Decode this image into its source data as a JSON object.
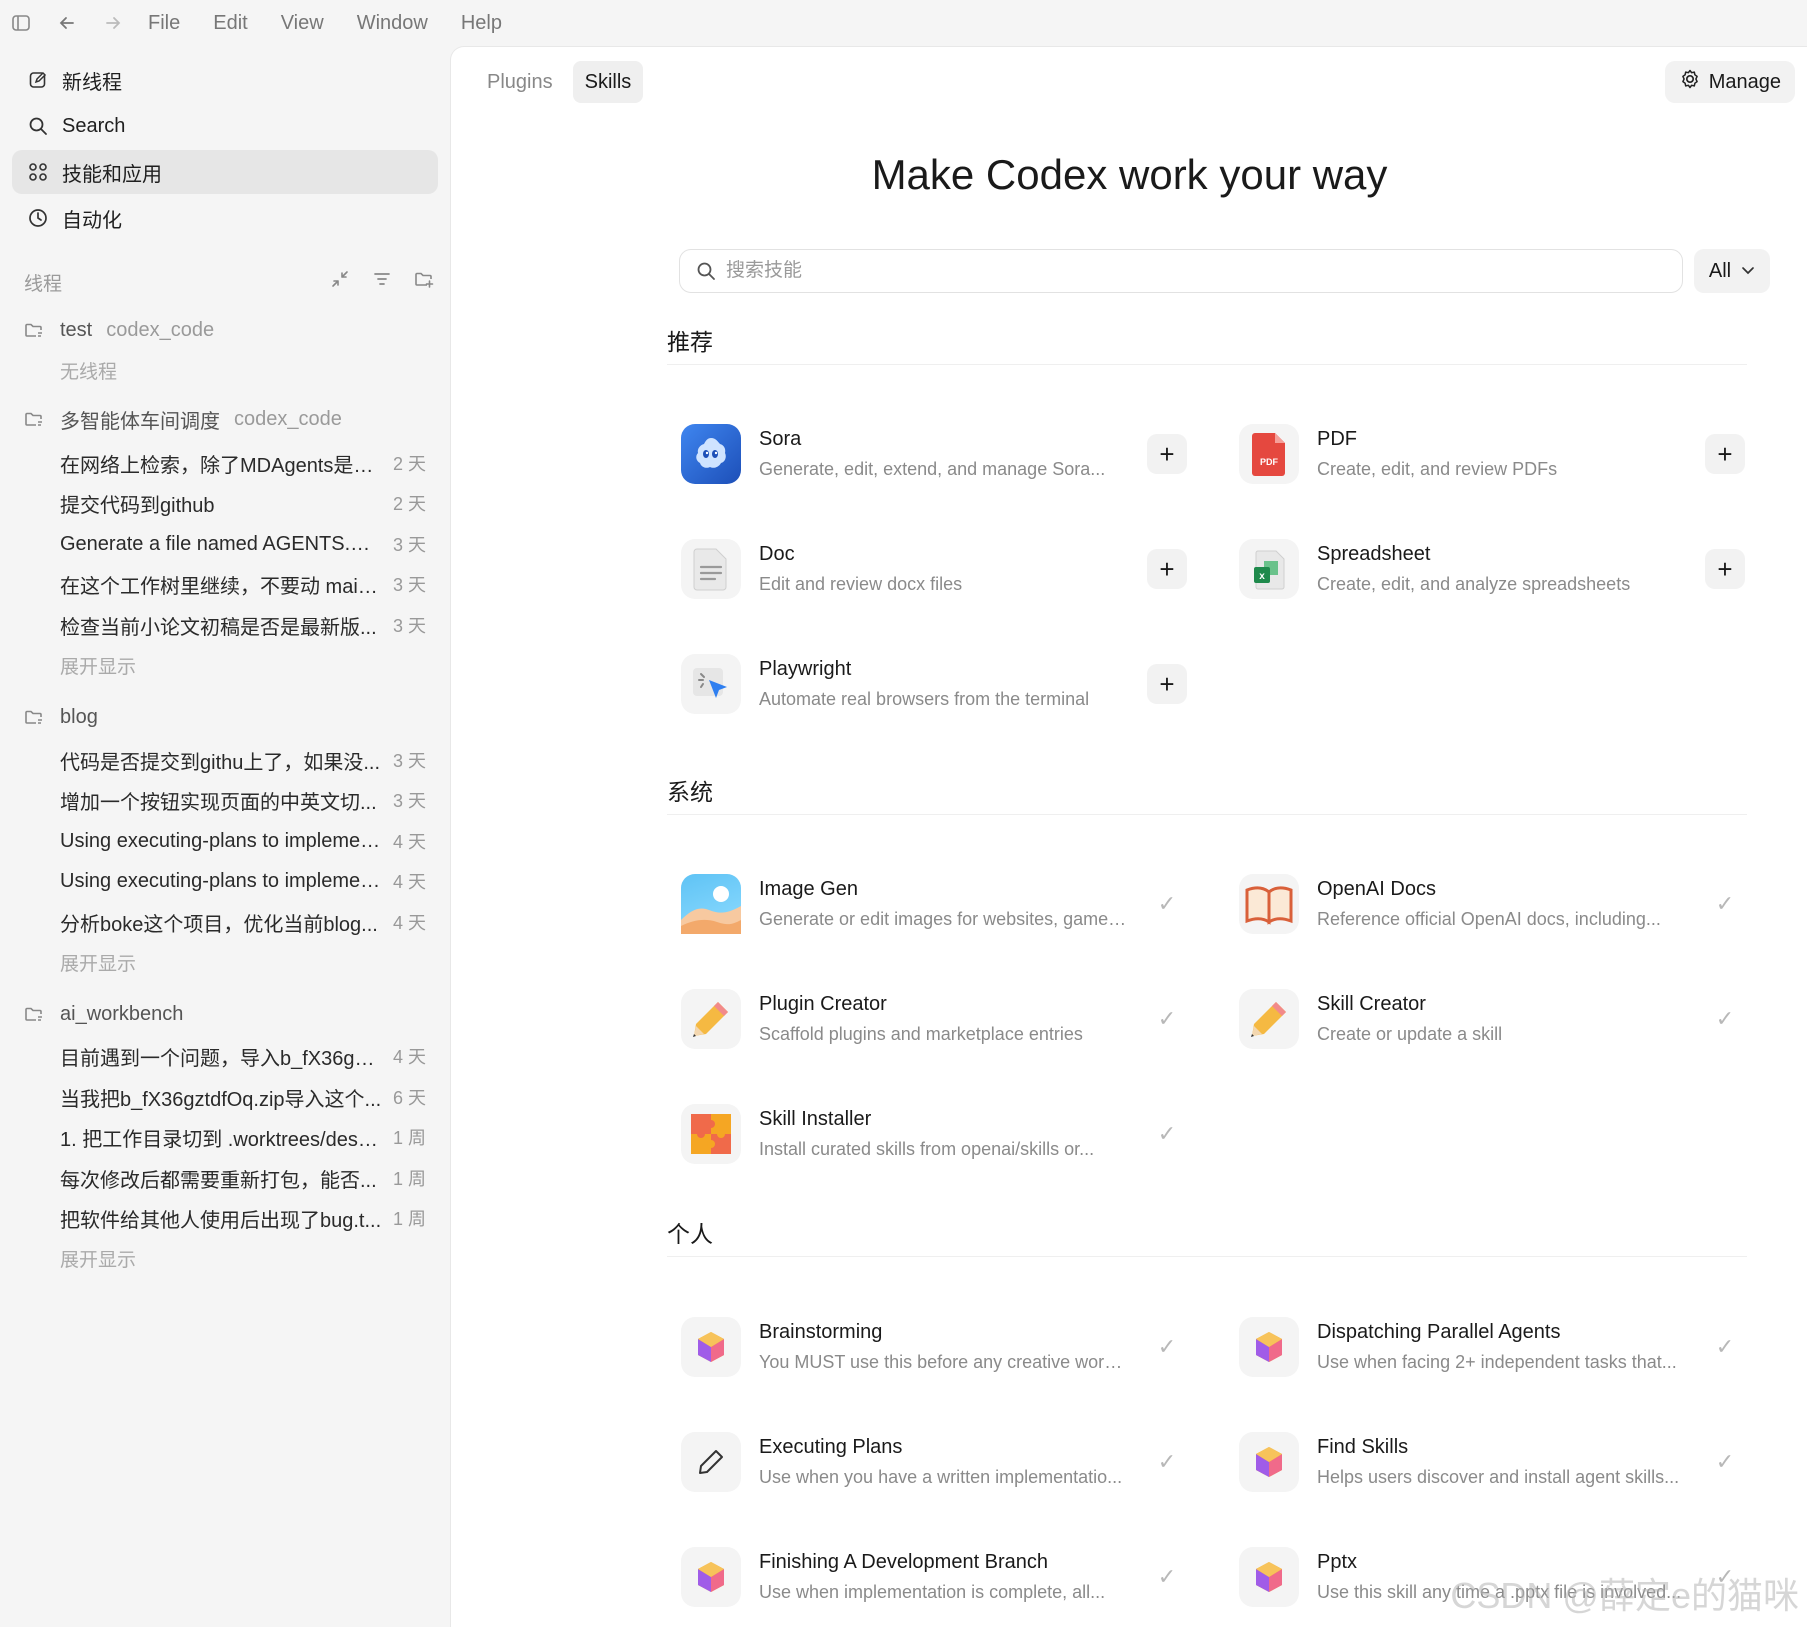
{
  "menubar": {
    "items": [
      "File",
      "Edit",
      "View",
      "Window",
      "Help"
    ]
  },
  "sidebar": {
    "nav": [
      {
        "label": "新线程",
        "icon": "edit-icon"
      },
      {
        "label": "Search",
        "icon": "search-icon"
      },
      {
        "label": "技能和应用",
        "icon": "apps-icon",
        "active": true
      },
      {
        "label": "自动化",
        "icon": "clock-icon"
      }
    ],
    "threads_heading": "线程",
    "projects": [
      {
        "name": "test",
        "sub": "codex_code",
        "empty": "无线程",
        "threads": []
      },
      {
        "name": "多智能体车间调度",
        "sub": "codex_code",
        "threads": [
          {
            "title": "在网络上检索，除了MDAgents是否...",
            "time": "2 天"
          },
          {
            "title": "提交代码到github",
            "time": "2 天"
          },
          {
            "title": "Generate a file named AGENTS.md ...",
            "time": "3 天"
          },
          {
            "title": "在这个工作树里继续，不要动 main...",
            "time": "3 天"
          },
          {
            "title": "检查当前小论文初稿是否是最新版...",
            "time": "3 天"
          }
        ],
        "expand": "展开显示"
      },
      {
        "name": "blog",
        "sub": "",
        "threads": [
          {
            "title": "代码是否提交到githu上了，如果没...",
            "time": "3 天"
          },
          {
            "title": "增加一个按钮实现页面的中英文切...",
            "time": "3 天"
          },
          {
            "title": "Using executing-plans to implemen...",
            "time": "4 天"
          },
          {
            "title": "Using executing-plans to implemen...",
            "time": "4 天"
          },
          {
            "title": "分析boke这个项目，优化当前blog...",
            "time": "4 天"
          }
        ],
        "expand": "展开显示"
      },
      {
        "name": "ai_workbench",
        "sub": "",
        "threads": [
          {
            "title": "目前遇到一个问题，导入b_fX36gzt...",
            "time": "4 天"
          },
          {
            "title": "当我把b_fX36gztdfOq.zip导入这个...",
            "time": "6 天"
          },
          {
            "title": "1. 把工作目录切到 .worktrees/deskt...",
            "time": "1 周"
          },
          {
            "title": "每次修改后都需要重新打包，能否...",
            "time": "1 周"
          },
          {
            "title": "把软件给其他人使用后出现了bug.t...",
            "time": "1 周"
          }
        ],
        "expand": "展开显示"
      }
    ]
  },
  "main": {
    "tabs": [
      {
        "label": "Plugins",
        "active": false
      },
      {
        "label": "Skills",
        "active": true
      }
    ],
    "manage_label": "Manage",
    "title": "Make Codex work your way",
    "search_placeholder": "搜索技能",
    "filter_value": "All",
    "groups": [
      {
        "heading": "推荐",
        "items": [
          {
            "name": "Sora",
            "desc": "Generate, edit, extend, and manage Sora...",
            "action": "add",
            "icon": "sora-icon"
          },
          {
            "name": "PDF",
            "desc": "Create, edit, and review PDFs",
            "action": "add",
            "icon": "pdf-icon",
            "badge": "PDF"
          },
          {
            "name": "Doc",
            "desc": "Edit and review docx files",
            "action": "add",
            "icon": "doc-icon"
          },
          {
            "name": "Spreadsheet",
            "desc": "Create, edit, and analyze spreadsheets",
            "action": "add",
            "icon": "spreadsheet-icon"
          },
          {
            "name": "Playwright",
            "desc": "Automate real browsers from the terminal",
            "action": "add",
            "icon": "playwright-icon"
          }
        ]
      },
      {
        "heading": "系统",
        "items": [
          {
            "name": "Image Gen",
            "desc": "Generate or edit images for websites, games...",
            "action": "check",
            "icon": "image-gen-icon"
          },
          {
            "name": "OpenAI Docs",
            "desc": "Reference official OpenAI docs, including...",
            "action": "check",
            "icon": "book-icon"
          },
          {
            "name": "Plugin Creator",
            "desc": "Scaffold plugins and marketplace entries",
            "action": "check",
            "icon": "pencil-icon"
          },
          {
            "name": "Skill Creator",
            "desc": "Create or update a skill",
            "action": "check",
            "icon": "pencil-icon"
          },
          {
            "name": "Skill Installer",
            "desc": "Install curated skills from openai/skills or...",
            "action": "check",
            "icon": "puzzle-icon"
          }
        ]
      },
      {
        "heading": "个人",
        "items": [
          {
            "name": "Brainstorming",
            "desc": "You MUST use this before any creative work ...",
            "action": "check",
            "icon": "cube-icon"
          },
          {
            "name": "Dispatching Parallel Agents",
            "desc": "Use when facing 2+ independent tasks that...",
            "action": "check",
            "icon": "cube-icon"
          },
          {
            "name": "Executing Plans",
            "desc": "Use when you have a written implementatio...",
            "action": "check",
            "icon": "pen-icon"
          },
          {
            "name": "Find Skills",
            "desc": "Helps users discover and install agent skills...",
            "action": "check",
            "icon": "cube-icon"
          },
          {
            "name": "Finishing A Development Branch",
            "desc": "Use when implementation is complete, all...",
            "action": "check",
            "icon": "cube-icon"
          },
          {
            "name": "Pptx",
            "desc": "Use this skill any time a .pptx file is involved...",
            "action": "check",
            "icon": "cube-icon"
          }
        ]
      }
    ]
  },
  "watermark": "CSDN @薛定e的猫咪",
  "colors": {
    "accent_sora": "#2f6bd8",
    "pdf_red": "#e5483f",
    "sheet_green": "#1f8a4c",
    "cube_orange": "#f5a623",
    "cube_purple": "#a05ce8"
  }
}
